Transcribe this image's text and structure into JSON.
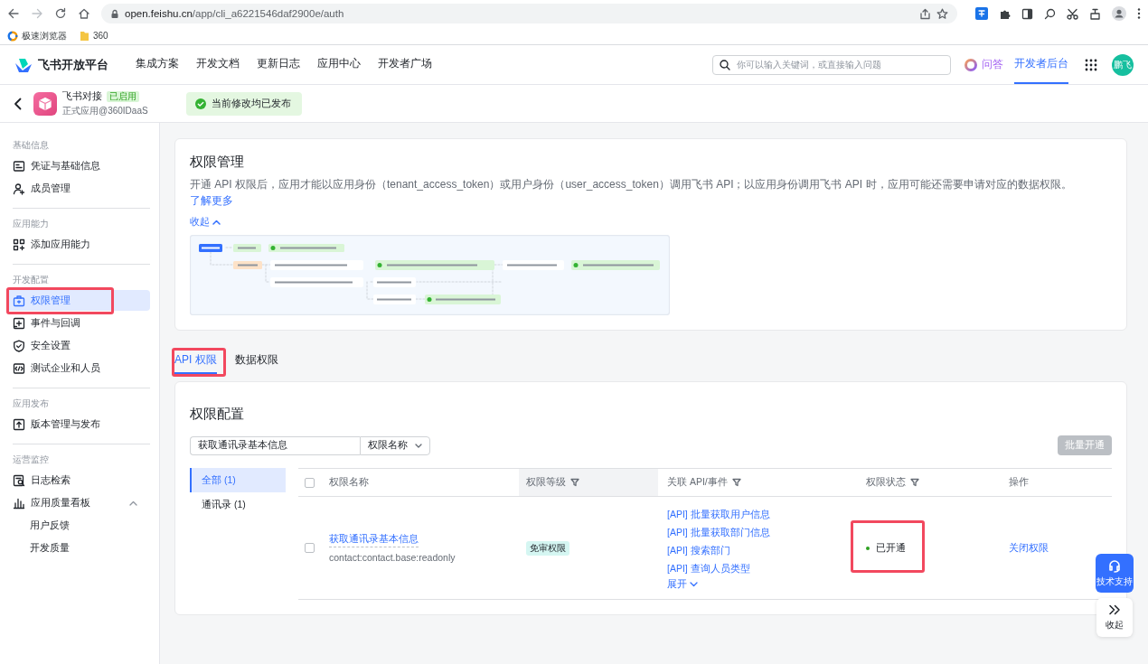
{
  "browser": {
    "url_host": "open.feishu.cn",
    "url_path": "/app/cli_a6221546daf2900e/auth",
    "bookmarks": [
      "极速浏览器",
      "360"
    ]
  },
  "header": {
    "logo": "飞书开放平台",
    "nav": [
      {
        "label": "集成方案",
        "selected": false
      },
      {
        "label": "开发文档",
        "selected": false
      },
      {
        "label": "更新日志",
        "selected": false
      },
      {
        "label": "应用中心",
        "selected": false
      },
      {
        "label": "开发者广场",
        "selected": false
      }
    ],
    "search": {
      "placeholder": "你可以输入关键词，或直接输入问题"
    },
    "ask": "问答",
    "console": {
      "label": "开发者后台",
      "selected": true
    },
    "avatar": "鹏飞"
  },
  "app": {
    "name": "飞书对接",
    "status": "已启用",
    "subtitle": "正式应用@360IDaaS",
    "notice": "当前修改均已发布"
  },
  "sidebar": {
    "groups": [
      {
        "title": "基础信息",
        "items": [
          {
            "label": "凭证与基础信息",
            "selected": false,
            "marked": false
          },
          {
            "label": "成员管理",
            "selected": false,
            "marked": false
          }
        ]
      },
      {
        "title": "应用能力",
        "items": [
          {
            "label": "添加应用能力",
            "selected": false,
            "marked": false
          }
        ]
      },
      {
        "title": "开发配置",
        "items": [
          {
            "label": "权限管理",
            "selected": true,
            "marked": true
          },
          {
            "label": "事件与回调",
            "selected": false,
            "marked": false
          },
          {
            "label": "安全设置",
            "selected": false,
            "marked": false
          },
          {
            "label": "测试企业和人员",
            "selected": false,
            "marked": false
          }
        ]
      },
      {
        "title": "应用发布",
        "items": [
          {
            "label": "版本管理与发布",
            "selected": false,
            "marked": false
          }
        ]
      },
      {
        "title": "运营监控",
        "items": [
          {
            "label": "日志检索",
            "selected": false,
            "marked": false
          },
          {
            "label": "应用质量看板",
            "selected": false,
            "marked": false,
            "expanded": true,
            "children": [
              {
                "label": "用户反馈",
                "selected": false,
                "marked": false
              },
              {
                "label": "开发质量",
                "selected": false,
                "marked": false
              }
            ]
          }
        ]
      }
    ]
  },
  "permissions": {
    "title": "权限管理",
    "description": "开通 API 权限后，应用才能以应用身份（tenant_access_token）或用户身份（user_access_token）调用飞书 API；以应用身份调用飞书 API 时，应用可能还需要申请对应的数据权限。",
    "learn_more": "了解更多",
    "collapse": "收起"
  },
  "tabs": [
    {
      "label": "API 权限",
      "selected": true,
      "marked": true
    },
    {
      "label": "数据权限",
      "selected": false,
      "marked": false
    }
  ],
  "config": {
    "title": "权限配置",
    "search": {
      "value": "获取通讯录基本信息"
    },
    "search_by": "权限名称",
    "batch_button": {
      "label": "批量开通",
      "disabled": true
    },
    "categories": [
      {
        "label": "全部 (1)",
        "selected": true
      },
      {
        "label": "通讯录 (1)",
        "selected": false
      }
    ],
    "table": {
      "select_all": {
        "checked": false
      },
      "columns": [
        {
          "label": "权限名称",
          "filter": false,
          "active": false
        },
        {
          "label": "权限等级",
          "filter": true,
          "active": true
        },
        {
          "label": "关联 API/事件",
          "filter": true,
          "active": false
        },
        {
          "label": "权限状态",
          "filter": true,
          "active": false
        },
        {
          "label": "操作",
          "filter": false,
          "active": false
        }
      ],
      "rows": [
        {
          "checked": false,
          "name": "获取通讯录基本信息",
          "scope": "contact:contact.base:readonly",
          "level": "免审权限",
          "apis": [
            "[API] 批量获取用户信息",
            "[API] 批量获取部门信息",
            "[API] 搜索部门",
            "[API] 查询人员类型"
          ],
          "expand": "展开",
          "status": {
            "label": "已开通",
            "color": "#2ea121",
            "marked": true
          },
          "action": "关闭权限"
        }
      ]
    }
  },
  "float": {
    "support": "技术支持",
    "collapse": "收起"
  }
}
